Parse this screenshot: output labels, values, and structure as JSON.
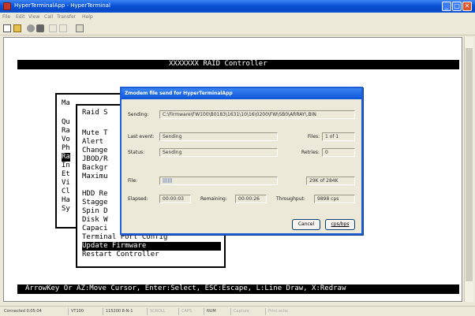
{
  "window": {
    "title": "HyperTerminalApp - HyperTerminal",
    "min": "_",
    "max": "□",
    "close": "✕"
  },
  "menu": [
    "File",
    "Edit",
    "View",
    "Call",
    "Transfer",
    "Help"
  ],
  "terminal": {
    "header": "XXXXXXX RAID Controller",
    "footer": "ArrowKey Or AZ:Move Cursor, Enter:Select, ESC:Escape, L:Line Draw, X:Redraw",
    "main_menu_title": "Ma",
    "main_menu_items": [
      "Qu",
      "Ra",
      "Vo",
      "Ph",
      "Ra",
      "In",
      "Et",
      "Vi",
      "Cl",
      "Ha",
      "Sy"
    ],
    "sub_menu_title": "Raid S",
    "sub_menu_items": [
      "Mute T",
      "Alert ",
      "Change",
      "JBOD/R",
      "Backgr",
      "Maximu",
      "Et",
      "HDD Re",
      "Stagge",
      "Spin D",
      "Disk W",
      "Capaci",
      "Terminal Port Config",
      "Update Firmware",
      "Restart Controller"
    ]
  },
  "dialog": {
    "title": "Zmodem file send for HyperTerminalApp",
    "sending_label": "Sending:",
    "sending_value": "C:\\Firmware\\FW100\\B0183\\1631\\10\\16\\0200\\FW\\SB0\\ARRAY\\.BIN",
    "last_event_label": "Last event:",
    "last_event_value": "Sending",
    "files_label": "Files:",
    "files_value": "1 of 1",
    "status_label": "Status:",
    "status_value": "Sending",
    "retries_label": "Retries:",
    "retries_value": "0",
    "file_label": "File:",
    "file_progress_text": "||||||",
    "file_size": "29K of 284K",
    "elapsed_label": "Elapsed:",
    "elapsed_value": "00:00:03",
    "remaining_label": "Remaining:",
    "remaining_value": "00:00:26",
    "throughput_label": "Throughput:",
    "throughput_value": "9898 cps",
    "cancel": "Cancel",
    "cps_bps": "cps/bps"
  },
  "status_bar": {
    "connected": "Connected 0:05:04",
    "emulation": "VT100",
    "settings": "115200 8-N-1",
    "scroll": "SCROLL",
    "caps": "CAPS",
    "num": "NUM",
    "capture": "Capture",
    "print_echo": "Print echo"
  }
}
